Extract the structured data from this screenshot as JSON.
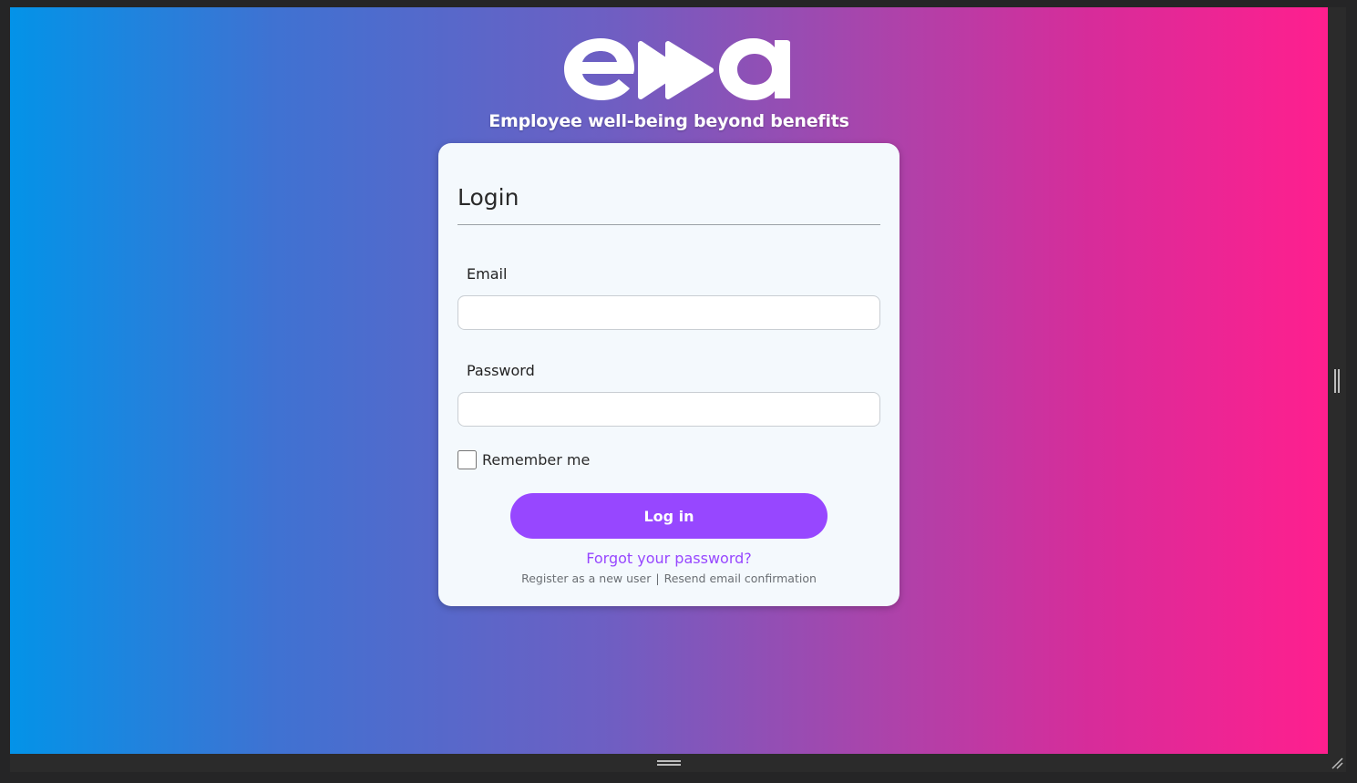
{
  "brand": {
    "logo_text": "ewa",
    "tagline": "Employee well-being beyond benefits"
  },
  "login": {
    "title": "Login",
    "email_label": "Email",
    "email_value": "",
    "password_label": "Password",
    "password_value": "",
    "remember_label": "Remember me",
    "remember_checked": false,
    "submit_label": "Log in",
    "forgot_link": "Forgot your password?",
    "register_link": "Register as a new user",
    "separator": "|",
    "resend_link": "Resend email confirmation"
  },
  "colors": {
    "gradient_start": "#0393e8",
    "gradient_end": "#ff1f8e",
    "accent": "#9747ff",
    "card_bg": "#f4f9fd"
  },
  "icons": {
    "logo": "ewa-logo",
    "resize_grip": "resize-grip-icon",
    "splitter_vertical": "splitter-handle-icon",
    "splitter_horizontal": "splitter-handle-icon"
  }
}
